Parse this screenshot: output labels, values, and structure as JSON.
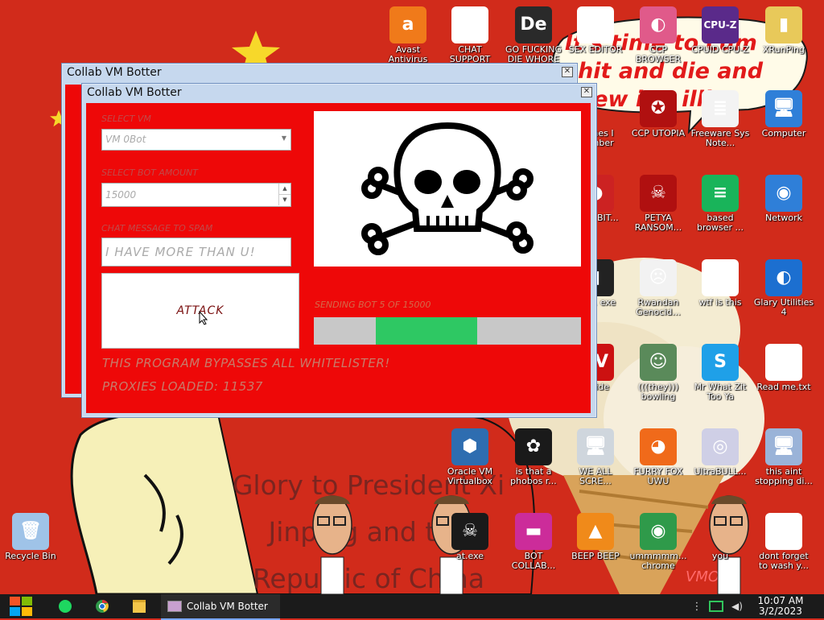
{
  "wallpaper": {
    "banner_text": "It's time to cum shit and die and chew ing illin",
    "poster_text": "Glory to President Xi Jinping and the Republic of China",
    "watermark": "VMOB"
  },
  "desktop_icons": [
    {
      "name": "avast-icon",
      "label": "Avast Antivirus",
      "glyph": "a",
      "color": "#f07a1a"
    },
    {
      "name": "chat-support-icon",
      "label": "CHAT SUPPORT",
      "glyph": "☺",
      "color": "#ffffff"
    },
    {
      "name": "die-icon",
      "label": "GO FUCKING DIE WHORE",
      "glyph": "De",
      "color": "#2a2a2a"
    },
    {
      "name": "hxd-icon",
      "label": "SEX EDITOR",
      "glyph": "HxD",
      "color": "#ffffff"
    },
    {
      "name": "ccp-browser-icon",
      "label": "CCP BROWSER",
      "glyph": "◐",
      "color": "#e05a8a"
    },
    {
      "name": "cpuz-icon",
      "label": "CPUID CPU-Z",
      "glyph": "CPU-Z",
      "color": "#5a2a8a"
    },
    {
      "name": "xrunping-icon",
      "label": "XRunPing",
      "glyph": "▮",
      "color": "#e8c95a"
    },
    {
      "name": "games-icon",
      "label": "Games I Member",
      "glyph": "",
      "color": "transparent"
    },
    {
      "name": "ccp-utopia-icon",
      "label": "CCP UTOPIA",
      "glyph": "✪",
      "color": "#b01010"
    },
    {
      "name": "freeware-icon",
      "label": "Freeware Sys Note...",
      "glyph": "≣",
      "color": "#f3f3f3"
    },
    {
      "name": "computer-icon",
      "label": "Computer",
      "glyph": "🖥",
      "color": "#2f7fd8"
    },
    {
      "name": "angry-icon",
      "label": "KING BIT...",
      "glyph": "●",
      "color": "#cc2222"
    },
    {
      "name": "petya-icon",
      "label": "PETYA RANSOM...",
      "glyph": "☠",
      "color": "#b01010"
    },
    {
      "name": "based-browser-icon",
      "label": "based browser ...",
      "glyph": "≡",
      "color": "#19b45a"
    },
    {
      "name": "network-icon",
      "label": "Network",
      "glyph": "◉",
      "color": "#2f7fd8"
    },
    {
      "name": "aly-icon",
      "label": "ALY... exe",
      "glyph": "▮",
      "color": "#222222"
    },
    {
      "name": "rwandan-icon",
      "label": "Rwandan Genocid...",
      "glyph": "☹",
      "color": "#f2f2f2"
    },
    {
      "name": "wtf-icon",
      "label": "wtf is this",
      "glyph": "▤",
      "color": "#ffffff"
    },
    {
      "name": "glary-icon",
      "label": "Glary Utilities 4",
      "glyph": "◐",
      "color": "#1c6fd0"
    },
    {
      "name": "dev-icon",
      "label": "da ide",
      "glyph": "EV",
      "color": "#cc1111"
    },
    {
      "name": "bowling-icon",
      "label": "(((they))) bowling",
      "glyph": "☺",
      "color": "#5a8a5a"
    },
    {
      "name": "skype-icon",
      "label": "Mr What Zit Too Ya",
      "glyph": "S",
      "color": "#1fa0e8"
    },
    {
      "name": "readme-icon",
      "label": "Read me.txt",
      "glyph": "▤",
      "color": "#ffffff"
    },
    {
      "name": "virtualbox-icon",
      "label": "Oracle VM Virtualbox",
      "glyph": "⬢",
      "color": "#2e6db0"
    },
    {
      "name": "phobos-icon",
      "label": "is that a phobos r...",
      "glyph": "✿",
      "color": "#1a1a1a"
    },
    {
      "name": "we-all-scre-icon",
      "label": "WE ALL SCRE...",
      "glyph": "🖥",
      "color": "#cfd6dd"
    },
    {
      "name": "firefox-icon",
      "label": "FURRY FOX UWU",
      "glyph": "◕",
      "color": "#f06a1a"
    },
    {
      "name": "ultrabull-icon",
      "label": "UltraBULL...",
      "glyph": "◎",
      "color": "#cfcfe6"
    },
    {
      "name": "this-aint-icon",
      "label": "this aint stopping di...",
      "glyph": "🖥",
      "color": "#9ab3d8"
    },
    {
      "name": "that-exe-icon",
      "label": "at.exe",
      "glyph": "☠",
      "color": "#1a1a1a"
    },
    {
      "name": "bot-collab-icon",
      "label": "BOT COLLAB...",
      "glyph": "▬",
      "color": "#cc2c9a"
    },
    {
      "name": "vlc-icon",
      "label": "BEEP BEEP",
      "glyph": "▲",
      "color": "#f08a1a"
    },
    {
      "name": "chrome-icon",
      "label": "ummmmm... chrome",
      "glyph": "◉",
      "color": "#2f9a4a"
    },
    {
      "name": "you-icon",
      "label": "you",
      "glyph": "",
      "color": "transparent"
    },
    {
      "name": "dont-forget-icon",
      "label": "dont forget to wash y...",
      "glyph": "▤",
      "color": "#ffffff"
    },
    {
      "name": "recycle-bin-icon",
      "label": "Recycle Bin",
      "glyph": "🗑",
      "color": "#9fc3e8"
    }
  ],
  "back_window": {
    "title": "Collab VM Botter"
  },
  "main_window": {
    "title": "Collab VM Botter",
    "select_vm_label": "SELECT VM",
    "select_vm_value": "VM 0Bot",
    "bot_amount_label": "SELECT BOT AMOUNT",
    "bot_amount_value": "15000",
    "chat_message_label": "CHAT MESSAGE TO SPAM",
    "chat_message_value": "I HAVE MORE THAN U!",
    "attack_label": "ATTACK",
    "sending_status": "SENDING BOT 5 OF 15000",
    "progress_fraction": 0.37,
    "bypass_text": "THIS PROGRAM BYPASSES ALL WHITELISTER!",
    "proxies_text": "PROXIES LOADED: 11537",
    "skull_icon": "skull-crossbones-icon"
  },
  "taskbar": {
    "start_icon": "windows-start-icon",
    "pinned": [
      "spotify-icon",
      "chrome-icon",
      "folder-icon"
    ],
    "active_task_label": "Collab VM Botter",
    "clock_time": "10:07 AM",
    "clock_date": "3/2/2023"
  }
}
